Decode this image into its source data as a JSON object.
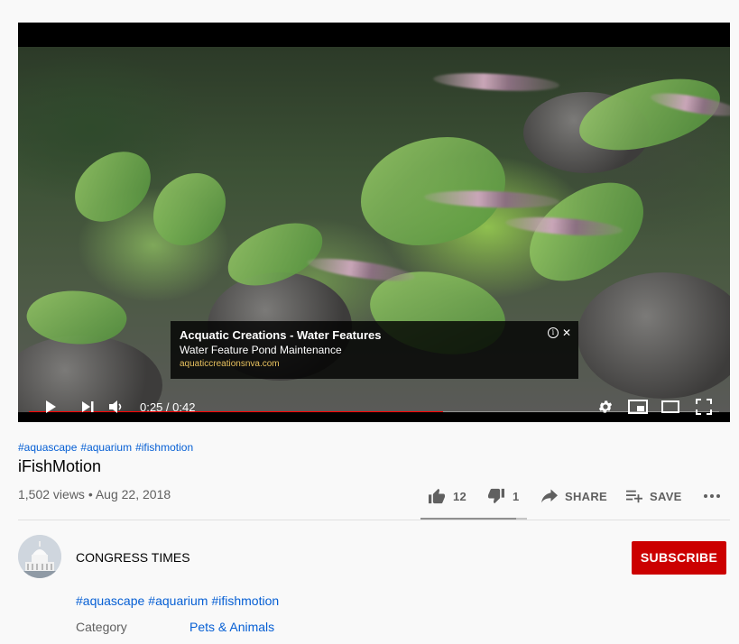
{
  "player": {
    "ad": {
      "title": "Acquatic Creations - Water Features",
      "subtitle": "Water Feature Pond Maintenance",
      "url": "aquaticcreationsnva.com"
    },
    "progress_fraction": 0.6,
    "time_display": "0:25 / 0:42",
    "progress_color": "#ff0000"
  },
  "video": {
    "hashtags": [
      "#aquascape",
      "#aquarium",
      "#ifishmotion"
    ],
    "title": "iFishMotion",
    "meta": "1,502 views • Aug 22, 2018"
  },
  "actions": {
    "like_count": "12",
    "dislike_count": "1",
    "share_label": "SHARE",
    "save_label": "SAVE"
  },
  "channel": {
    "name": "CONGRESS TIMES",
    "subscribe_label": "SUBSCRIBE",
    "subscribe_color": "#cc0000"
  },
  "description": {
    "hashtags": [
      "#aquascape",
      "#aquarium",
      "#ifishmotion"
    ],
    "category_label": "Category",
    "category_value": "Pets & Animals"
  }
}
